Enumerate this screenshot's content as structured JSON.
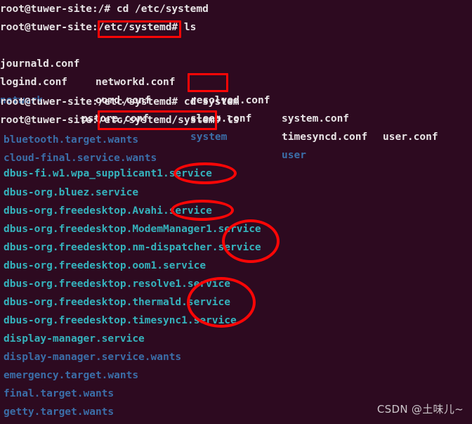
{
  "terminal": {
    "background_color": "#2d0a20",
    "text_color": "#e8e4e6",
    "dir_color": "#3b6ea8",
    "symlink_color": "#35b3bd",
    "annotation_color": "#fc0606",
    "lines": [
      {
        "id": "l0",
        "text": "root@tuwer-site:/# cd /etc/systemd"
      },
      {
        "id": "l1",
        "text": "root@tuwer-site:/etc/systemd# ls"
      },
      {
        "id": "l2a",
        "text": "journald.conf"
      },
      {
        "id": "l2b",
        "text": "networkd.conf"
      },
      {
        "id": "l2c",
        "text": "resolved.conf"
      },
      {
        "id": "l2d",
        "text": "system.conf"
      },
      {
        "id": "l2e",
        "text": "user.conf"
      },
      {
        "id": "l3a",
        "text": "logind.conf"
      },
      {
        "id": "l3b",
        "text": "oomd.conf"
      },
      {
        "id": "l3c",
        "text": "sleep.conf"
      },
      {
        "id": "l3d",
        "text": "timesyncd.conf"
      },
      {
        "id": "l4a",
        "text": "network"
      },
      {
        "id": "l4b",
        "text": "pstore.conf"
      },
      {
        "id": "l4c",
        "text": "system"
      },
      {
        "id": "l4d",
        "text": "user"
      },
      {
        "id": "l5",
        "text": "root@tuwer-site:/etc/systemd# cd system"
      },
      {
        "id": "l6",
        "text": "root@tuwer-site:/etc/systemd/system# ls"
      },
      {
        "id": "l7",
        "text": "bluetooth.target.wants"
      },
      {
        "id": "l8",
        "text": "cloud-final.service.wants"
      },
      {
        "id": "l9",
        "text": "dbus-fi.w1.wpa_supplicant1.service"
      },
      {
        "id": "l10",
        "text": "dbus-org.bluez.service"
      },
      {
        "id": "l11",
        "text": "dbus-org.freedesktop.Avahi.service"
      },
      {
        "id": "l12",
        "text": "dbus-org.freedesktop.ModemManager1.service"
      },
      {
        "id": "l13",
        "text": "dbus-org.freedesktop.nm-dispatcher.service"
      },
      {
        "id": "l14",
        "text": "dbus-org.freedesktop.oom1.service"
      },
      {
        "id": "l15",
        "text": "dbus-org.freedesktop.resolve1.service"
      },
      {
        "id": "l16",
        "text": "dbus-org.freedesktop.thermald.service"
      },
      {
        "id": "l17",
        "text": "dbus-org.freedesktop.timesync1.service"
      },
      {
        "id": "l18",
        "text": "display-manager.service"
      },
      {
        "id": "l19",
        "text": "display-manager.service.wants"
      },
      {
        "id": "l20",
        "text": "emergency.target.wants"
      },
      {
        "id": "l21",
        "text": "final.target.wants"
      },
      {
        "id": "l22",
        "text": "getty.target.wants"
      }
    ],
    "annotations": [
      {
        "id": "a0",
        "shape": "rect",
        "label": "highlight-box-etc-systemd-prompt"
      },
      {
        "id": "a1",
        "shape": "rect",
        "label": "highlight-box-system-directory"
      },
      {
        "id": "a2",
        "shape": "rect",
        "label": "highlight-box-etc-systemd-system-prompt"
      },
      {
        "id": "a3",
        "shape": "ellipse",
        "label": "highlight-ellipse-wpa-supplicant-service"
      },
      {
        "id": "a4",
        "shape": "ellipse",
        "label": "highlight-ellipse-avahi-service"
      },
      {
        "id": "a5",
        "shape": "ellipse",
        "label": "highlight-ellipse-modemmanager-nm-dispatcher-service"
      },
      {
        "id": "a6",
        "shape": "ellipse",
        "label": "highlight-ellipse-resolve-thermald-timesync-service"
      }
    ]
  },
  "watermark": {
    "text": "CSDN @土味儿~"
  }
}
